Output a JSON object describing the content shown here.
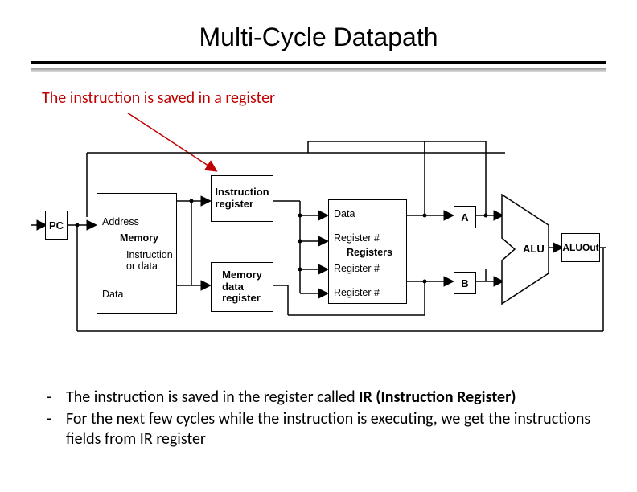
{
  "title": "Multi-Cycle Datapath",
  "annotation": "The instruction is saved in a register",
  "diagram": {
    "pc": "PC",
    "memory": {
      "name": "Memory",
      "ports": {
        "address": "Address",
        "instr_or_data": "Instruction\nor data",
        "data": "Data"
      }
    },
    "ir": "Instruction\nregister",
    "mdr": "Memory\ndata\nregister",
    "registers": {
      "name": "Registers",
      "data": "Data",
      "reg1": "Register #",
      "reg2": "Register #",
      "reg3": "Register #"
    },
    "a": "A",
    "b": "B",
    "alu": "ALU",
    "aluout": "ALUOut"
  },
  "bullets": [
    {
      "plain_before": "The instruction is saved in the register called ",
      "bold": "IR (Instruction Register)",
      "plain_after": ""
    },
    {
      "plain_before": "For the next few cycles while the instruction is executing, we get the instructions fields from IR register",
      "bold": "",
      "plain_after": ""
    }
  ]
}
